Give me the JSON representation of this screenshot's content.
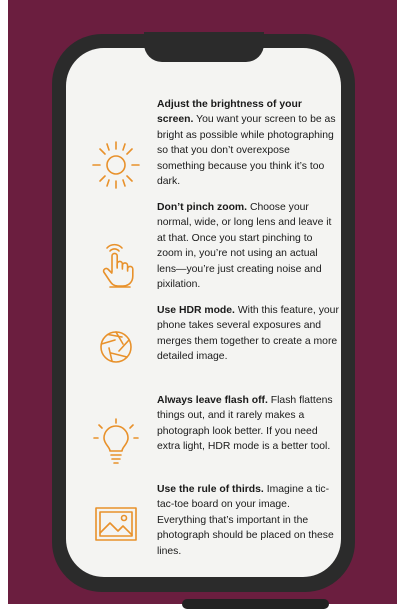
{
  "colors": {
    "backdrop": "#6b1e3f",
    "phone_frame": "#2b2b2b",
    "screen": "#f4f4f2",
    "icon_accent": "#e8912b",
    "text": "#1a1a1a"
  },
  "tips": [
    {
      "icon": "sun-icon",
      "heading": "Adjust the brightness of your screen.",
      "body": "You want your screen to be as bright as possible while photographing so that you don’t overexpose something because you think it’s too dark."
    },
    {
      "icon": "pinch-hand-icon",
      "heading": "Don’t pinch zoom.",
      "body": "Choose your normal, wide, or long lens and leave it at that. Once you start pinching to zoom in, you’re not using an actual lens—you’re just creating noise and pixilation."
    },
    {
      "icon": "aperture-icon",
      "heading": "Use HDR mode.",
      "body": "With this feature, your phone takes several exposures and merges them together to create a more detailed image."
    },
    {
      "icon": "lightbulb-icon",
      "heading": "Always leave flash off.",
      "body": "Flash flattens things out, and it rarely makes a photograph look better. If you need extra light, HDR mode is a better tool."
    },
    {
      "icon": "image-icon",
      "heading": "Use the rule of thirds.",
      "body": "Imagine a tic-tac-toe board on your image. Everything that’s important in the photograph should be placed on these lines."
    }
  ]
}
